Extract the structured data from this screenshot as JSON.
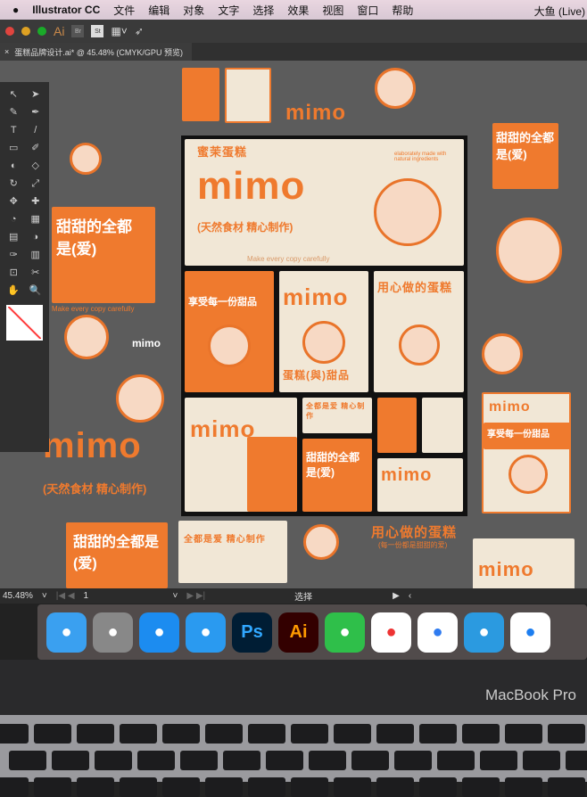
{
  "menubar": {
    "apple": "",
    "app": "Illustrator CC",
    "items": [
      "文件",
      "编辑",
      "对象",
      "文字",
      "选择",
      "效果",
      "视图",
      "窗口",
      "帮助"
    ],
    "user": "大鱼 (Live)"
  },
  "appbar": {
    "ai": "Ai",
    "br": "Br",
    "st": "St"
  },
  "tab": {
    "close": "×",
    "title": "蛋糕品牌设计.ai* @ 45.48% (CMYK/GPU 预览)"
  },
  "tools": [
    "↖",
    "➤",
    "✎",
    "✒",
    "T",
    "/",
    "▭",
    "✐",
    "◐",
    "◇",
    "↻",
    "⤢",
    "✥",
    "✚",
    "◔",
    "▦",
    "▤",
    "◑",
    "✑",
    "▥",
    "⊡",
    "✂",
    "✋",
    "🔍"
  ],
  "status": {
    "zoom": "45.48%",
    "page": "1",
    "mode": "选择"
  },
  "artwork": {
    "brand": "mimo",
    "brand_cn": "蜜茉蛋糕",
    "tagline": "(天然食材 精心制作)",
    "slogan": "Make every copy carefully",
    "love": "甜甜的全都是(爱)",
    "enjoy": "享受每一份甜品",
    "heart": "用心做的蛋糕",
    "sub": "(每一份都是甜甜的爱)",
    "cake": "蛋糕(與)甜品",
    "made": "elaborately made with natural ingredients",
    "all": "全都是爱 精心制作"
  },
  "dock": [
    "Finder",
    "Launchpad",
    "App Store",
    "QQ",
    "Ps",
    "Ai",
    "Pen",
    "Chrome",
    "Baidu",
    "Archive",
    "Safari"
  ],
  "bezel": {
    "label": "MacBook Pro"
  },
  "colors": {
    "accent": "#ef7a2e",
    "cream": "#f1e7d6",
    "canvas": "#5c5c5c"
  }
}
